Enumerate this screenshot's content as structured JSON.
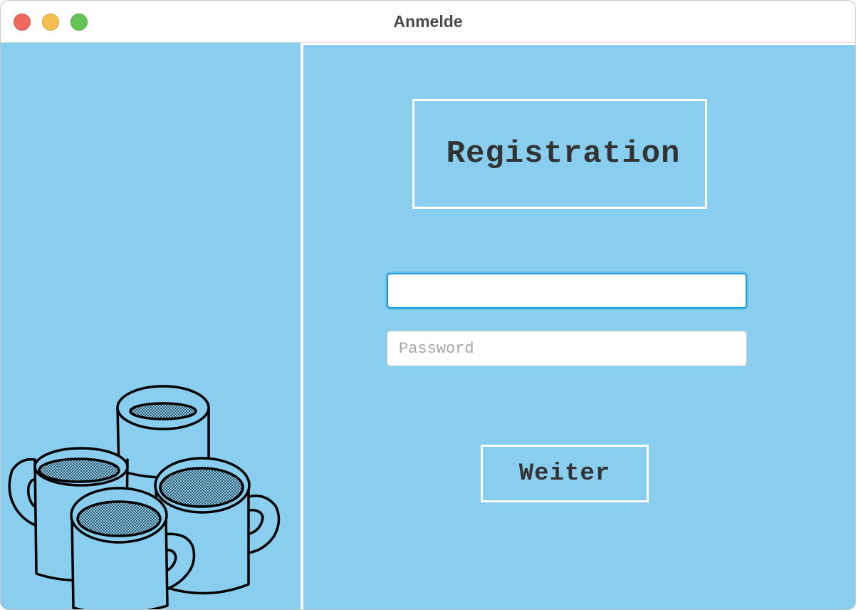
{
  "window": {
    "title": "Anmelde"
  },
  "form": {
    "heading": "Registration",
    "username": {
      "value": "",
      "placeholder": ""
    },
    "password": {
      "value": "",
      "placeholder": "Password"
    },
    "submit_label": "Weiter"
  },
  "illustration": {
    "icon": "coffee-mugs-illustration"
  },
  "colors": {
    "background": "#89cdef",
    "border": "#ffffff",
    "text": "#333333",
    "focus": "#1b9ad6"
  }
}
